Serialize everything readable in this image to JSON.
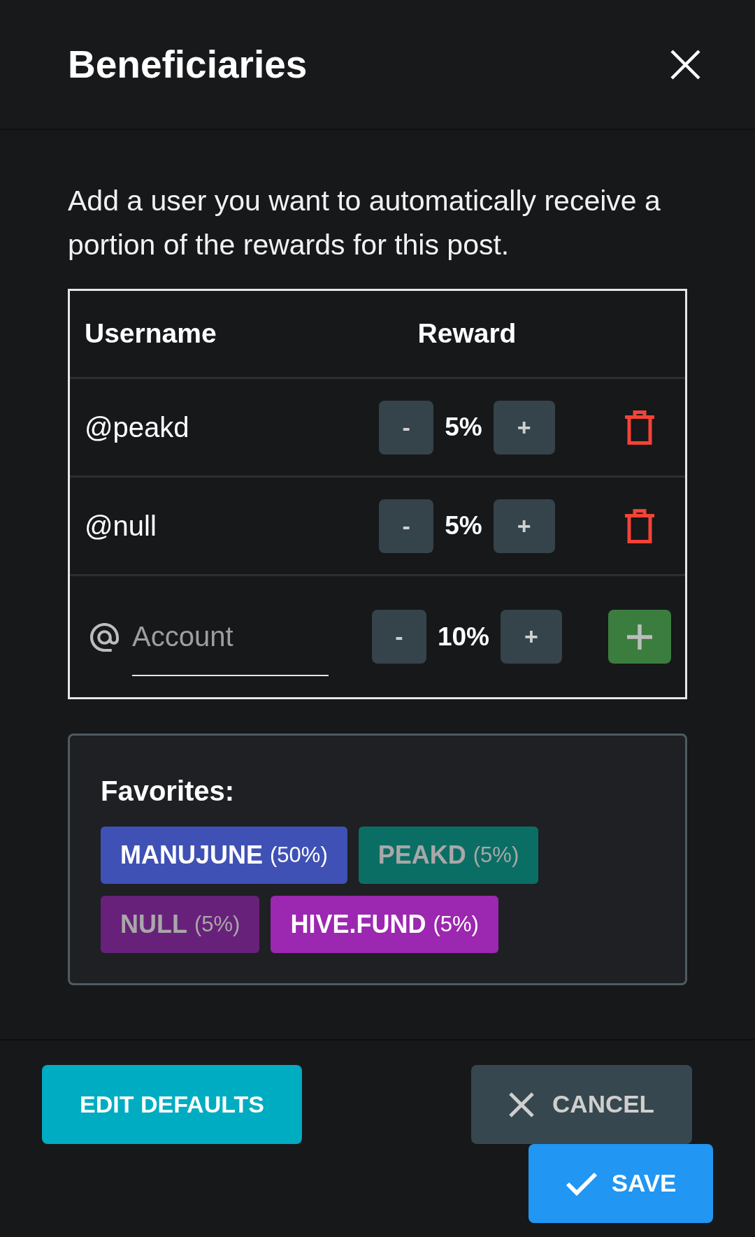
{
  "dialog": {
    "title": "Beneficiaries"
  },
  "description": "Add a user you want to automatically receive a portion of the rewards for this post.",
  "table": {
    "columns": [
      "Username",
      "Reward"
    ],
    "rows": [
      {
        "username": "@peakd",
        "decrease": "-",
        "reward": "5%",
        "increase": "+"
      },
      {
        "username": "@null",
        "decrease": "-",
        "reward": "5%",
        "increase": "+"
      }
    ],
    "new_entry": {
      "placeholder": "Account",
      "decrease": "-",
      "reward": "10%",
      "increase": "+"
    }
  },
  "favorites": {
    "title": "Favorites:",
    "chips": [
      {
        "name": "MANUJUNE",
        "share": "(50%)",
        "color": "#3f51b5",
        "disabled": false
      },
      {
        "name": "PEAKD",
        "share": "(5%)",
        "color": "#0b6e64",
        "disabled": true
      },
      {
        "name": "NULL",
        "share": "(5%)",
        "color": "#68217a",
        "disabled": true
      },
      {
        "name": "HIVE.FUND",
        "share": "(5%)",
        "color": "#9c27b0",
        "disabled": false
      }
    ]
  },
  "buttons": [
    {
      "kind": "edit",
      "label": "EDIT DEFAULTS"
    },
    {
      "kind": "cancel",
      "label": "CANCEL"
    },
    {
      "kind": "save",
      "label": "SAVE"
    }
  ]
}
